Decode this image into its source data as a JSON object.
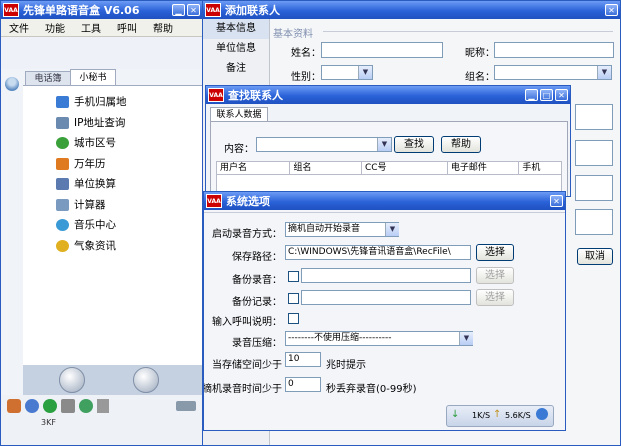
{
  "main": {
    "title": "先锋单路语音盒  V6.06",
    "logo": "VAA",
    "menu": [
      "文件",
      "功能",
      "工具",
      "呼叫",
      "帮助"
    ],
    "tabs": [
      "电话簿",
      "小秘书"
    ],
    "items": [
      {
        "label": "手机归属地",
        "icon": "mobile-icon",
        "color": "#3a7bd5"
      },
      {
        "label": "IP地址查询",
        "icon": "computer-icon",
        "color": "#6a8ab0"
      },
      {
        "label": "城市区号",
        "icon": "globe-icon",
        "color": "#3aa03a"
      },
      {
        "label": "万年历",
        "icon": "calendar-icon",
        "color": "#e07a20"
      },
      {
        "label": "单位换算",
        "icon": "convert-icon",
        "color": "#5a7ab0"
      },
      {
        "label": "计算器",
        "icon": "calculator-icon",
        "color": "#7a9ac0"
      },
      {
        "label": "音乐中心",
        "icon": "music-icon",
        "color": "#3a9ad5"
      },
      {
        "label": "气象资讯",
        "icon": "weather-icon",
        "color": "#e0b020"
      }
    ],
    "bottom_text": "3KF"
  },
  "add_contact": {
    "title": "添加联系人",
    "nav": [
      "基本信息",
      "单位信息",
      "备注"
    ],
    "section": "基本资料",
    "name_label": "姓名：",
    "nick_label": "昵称：",
    "gender_label": "性别：",
    "group_label": "组名：",
    "cancel": "取消"
  },
  "find_contact": {
    "title": "查找联系人",
    "tab": "联系人数据",
    "content_label": "内容：",
    "find": "查找",
    "help": "帮助",
    "columns": [
      "用户名",
      "组名",
      "CC号",
      "电子邮件",
      "手机"
    ]
  },
  "options": {
    "title": "系统选项",
    "start_label": "启动录音方式：",
    "start_value": "摘机自动开始录音",
    "path_label": "保存路径：",
    "path_value": "C:\\WINDOWS\\先锋音讯语音盒\\RecFile\\",
    "select": "选择",
    "backup_rec_label": "备份录音：",
    "backup_log_label": "备份记录：",
    "input_call_label": "输入呼叫说明：",
    "compress_label": "录音压缩：",
    "compress_value": "--------不使用压缩----------",
    "storage_label": "当存储空间少于",
    "storage_value": "10",
    "storage_suffix": "兆时提示",
    "discard_label": "摘机录音时间少于",
    "discard_value": "0",
    "discard_suffix": "秒丢弃录音(0-99秒)",
    "speed_down": "1K/S",
    "speed_up": "5.6K/S"
  }
}
